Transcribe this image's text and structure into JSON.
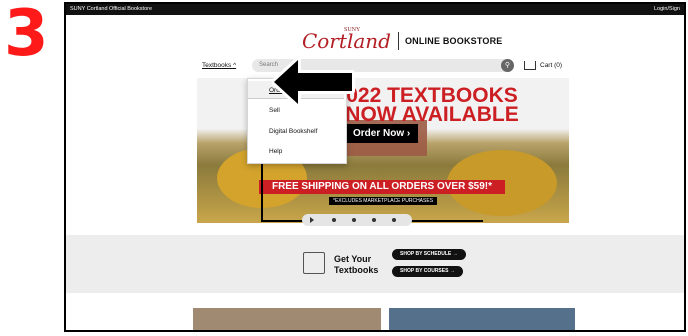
{
  "step": "3",
  "topbar": {
    "left": "SUNY Cortland Official Bookstore",
    "right": "Login/Sign"
  },
  "logo": {
    "suny": "SUNY",
    "cortland": "Cortland",
    "bookstore": "ONLINE BOOKSTORE"
  },
  "nav": {
    "textbooks_label": "Textbooks ^",
    "search_placeholder": "Search",
    "cart_label": "Cart (0)"
  },
  "dropdown": {
    "items": [
      "Order",
      "Sell",
      "Digital Bookshelf",
      "Help"
    ]
  },
  "hero": {
    "headline_line1": "022 TEXTBOOKS",
    "headline_line2": "NOW AVAILABLE",
    "order_button": "Order Now ›",
    "shipping": "FREE SHIPPING ON ALL ORDERS OVER $59!*",
    "excludes": "*EXCLUDES MARKETPLACE PURCHASES"
  },
  "band": {
    "get_your": "Get Your",
    "textbooks": "Textbooks",
    "by_schedule": "SHOP BY SCHEDULE →",
    "by_courses": "SHOP BY COURSES →"
  },
  "colors": {
    "brand_red": "#cc1f24",
    "annotation_red": "#ff1a1a"
  }
}
